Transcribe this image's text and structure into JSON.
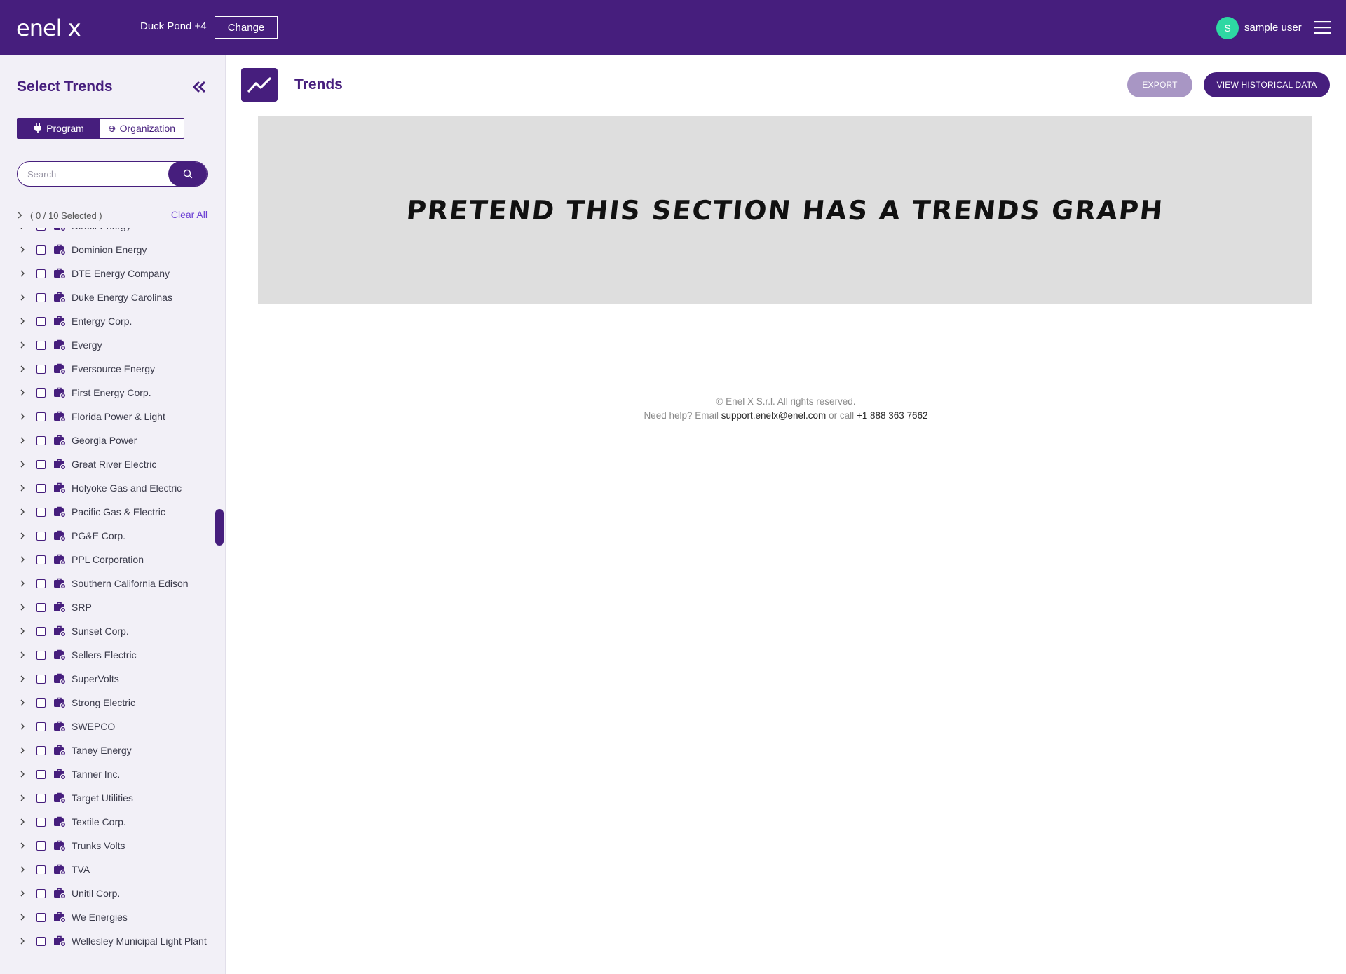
{
  "header": {
    "logo_text": "enel x",
    "site_label": "Duck Pond +4",
    "change_label": "Change",
    "avatar_initial": "S",
    "user_name": "sample user",
    "colors": {
      "brand": "#461e7d",
      "avatar": "#2ed8a3"
    }
  },
  "sidebar": {
    "title": "Select Trends",
    "toggle": {
      "program_label": "Program",
      "organization_label": "Organization",
      "active": "Program"
    },
    "search": {
      "placeholder": "Search",
      "value": ""
    },
    "selected_count": "( 0 / 10 Selected )",
    "clear_all_label": "Clear All",
    "items": [
      {
        "label": "Direct Energy"
      },
      {
        "label": "Dominion Energy"
      },
      {
        "label": "DTE Energy Company"
      },
      {
        "label": "Duke Energy Carolinas"
      },
      {
        "label": "Entergy Corp."
      },
      {
        "label": "Evergy"
      },
      {
        "label": "Eversource Energy"
      },
      {
        "label": "First Energy Corp."
      },
      {
        "label": "Florida Power & Light"
      },
      {
        "label": "Georgia Power"
      },
      {
        "label": "Great River Electric"
      },
      {
        "label": "Holyoke Gas and Electric"
      },
      {
        "label": "Pacific Gas & Electric"
      },
      {
        "label": "PG&E Corp."
      },
      {
        "label": "PPL Corporation"
      },
      {
        "label": "Southern California Edison"
      },
      {
        "label": "SRP"
      },
      {
        "label": "Sunset Corp."
      },
      {
        "label": "Sellers Electric"
      },
      {
        "label": "SuperVolts"
      },
      {
        "label": "Strong Electric"
      },
      {
        "label": "SWEPCO"
      },
      {
        "label": "Taney Energy"
      },
      {
        "label": " Tanner Inc."
      },
      {
        "label": "Target Utilities"
      },
      {
        "label": "Textile Corp."
      },
      {
        "label": "Trunks Volts"
      },
      {
        "label": "TVA"
      },
      {
        "label": "Unitil Corp."
      },
      {
        "label": "We Energies"
      },
      {
        "label": "Wellesley Municipal Light Plant"
      }
    ]
  },
  "main": {
    "title": "Trends",
    "export_label": "EXPORT",
    "history_label": "VIEW HISTORICAL DATA",
    "graph_placeholder_text": "PRETEND THIS SECTION HAS A TRENDS GRAPH"
  },
  "footer": {
    "copyright": "© Enel X S.r.l. All rights reserved.",
    "help_prefix": "Need help? Email ",
    "email": "support.enelx@enel.com",
    "or_call": " or call ",
    "phone": "+1 888 363 7662"
  }
}
